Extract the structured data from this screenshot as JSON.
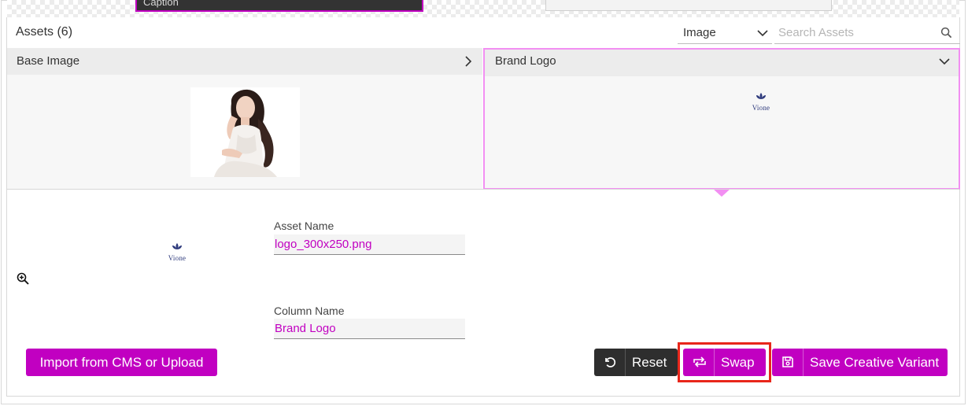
{
  "top_strip": {
    "caption_text": "Caption"
  },
  "assets": {
    "title": "Assets (6)",
    "type_filter": {
      "selected": "Image"
    },
    "search": {
      "placeholder": "Search Assets",
      "value": ""
    }
  },
  "columns": [
    {
      "label": "Base Image",
      "expanded": false
    },
    {
      "label": "Brand Logo",
      "expanded": true
    }
  ],
  "logo_text": "Vione",
  "details": {
    "asset_name_label": "Asset Name",
    "asset_name_value": "logo_300x250.png",
    "column_name_label": "Column Name",
    "column_name_value": "Brand Logo"
  },
  "buttons": {
    "import": "Import from CMS or Upload",
    "reset": "Reset",
    "swap": "Swap",
    "save": "Save Creative Variant"
  },
  "colors": {
    "accent": "#c100c1",
    "dark": "#2e2e2e",
    "highlight": "#f28ff2",
    "focus_outline": "#e8261b"
  }
}
